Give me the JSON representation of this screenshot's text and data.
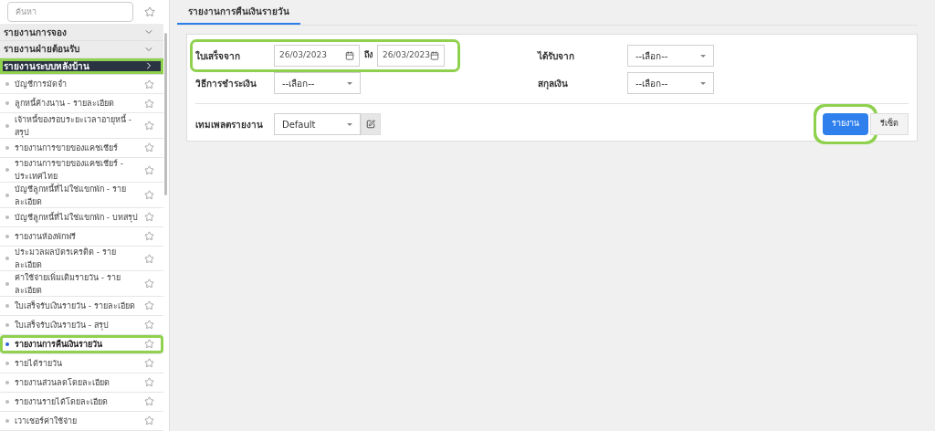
{
  "sidebar": {
    "search": {
      "placeholder": "ค้นหา"
    },
    "sections": [
      {
        "label": "รายงานการจอง",
        "expanded": false,
        "active": false,
        "highlighted": false
      },
      {
        "label": "รายงานฝ่ายต้อนรับ",
        "expanded": false,
        "active": false,
        "highlighted": false
      },
      {
        "label": "รายงานระบบหลังบ้าน",
        "expanded": true,
        "active": true,
        "highlighted": true
      }
    ],
    "items": [
      {
        "label": "บัญชีการมัดจำ",
        "selected": false,
        "highlighted": false
      },
      {
        "label": "ลูกหนี้ค้างนาน - รายละเอียด",
        "selected": false,
        "highlighted": false
      },
      {
        "label": "เจ้าหนี้ของรอบระยะเวลาอายุหนี้ - สรุป",
        "selected": false,
        "highlighted": false
      },
      {
        "label": "รายงานการขายของแคชเชียร์",
        "selected": false,
        "highlighted": false
      },
      {
        "label": "รายงานการขายของแคชเชียร์ - ประเทศไทย",
        "selected": false,
        "highlighted": false
      },
      {
        "label": "บัญชีลูกหนี้ที่ไม่ใช่แขกพัก - รายละเอียด",
        "selected": false,
        "highlighted": false
      },
      {
        "label": "บัญชีลูกหนี้ที่ไม่ใช่แขกพัก - บทสรุป",
        "selected": false,
        "highlighted": false
      },
      {
        "label": "รายงานห้องพักฟรี",
        "selected": false,
        "highlighted": false
      },
      {
        "label": "ประมวลผลบัตรเครดิต - รายละเอียด",
        "selected": false,
        "highlighted": false
      },
      {
        "label": "ค่าใช้จ่ายเพิ่มเติมรายวัน - รายละเอียด",
        "selected": false,
        "highlighted": false
      },
      {
        "label": "ใบเสร็จรับเงินรายวัน - รายละเอียด",
        "selected": false,
        "highlighted": false
      },
      {
        "label": "ใบเสร็จรับเงินรายวัน - สรุป",
        "selected": false,
        "highlighted": false
      },
      {
        "label": "รายงานการคืนเงินรายวัน",
        "selected": true,
        "highlighted": true
      },
      {
        "label": "รายได้รายวัน",
        "selected": false,
        "highlighted": false
      },
      {
        "label": "รายงานส่วนลดโดยละเอียด",
        "selected": false,
        "highlighted": false
      },
      {
        "label": "รายงานรายได้โดยละเอียด",
        "selected": false,
        "highlighted": false
      },
      {
        "label": "เวาเชอร์ค่าใช้จ่าย",
        "selected": false,
        "highlighted": false
      }
    ]
  },
  "tabs": [
    {
      "label": "รายงานการคืนเงินรายวัน",
      "selected": true
    }
  ],
  "form": {
    "receipt_from": {
      "label": "ใบเสร็จจาก",
      "from": "26/03/2023",
      "to_label": "ถึง",
      "to": "26/03/2023",
      "highlighted": true
    },
    "payment_method": {
      "label": "วิธีการชำระเงิน",
      "value": "--เลือก--"
    },
    "received_from": {
      "label": "ได้รับจาก",
      "value": "--เลือก--"
    },
    "currency": {
      "label": "สกุลเงิน",
      "value": "--เลือก--"
    },
    "template": {
      "label": "เทมเพลตรายงาน",
      "value": "Default"
    },
    "buttons": [
      {
        "label": "รายงาน",
        "kind": "primary",
        "highlighted": true
      },
      {
        "label": "รีเซ็ต",
        "kind": "secondary",
        "highlighted": false
      }
    ]
  }
}
